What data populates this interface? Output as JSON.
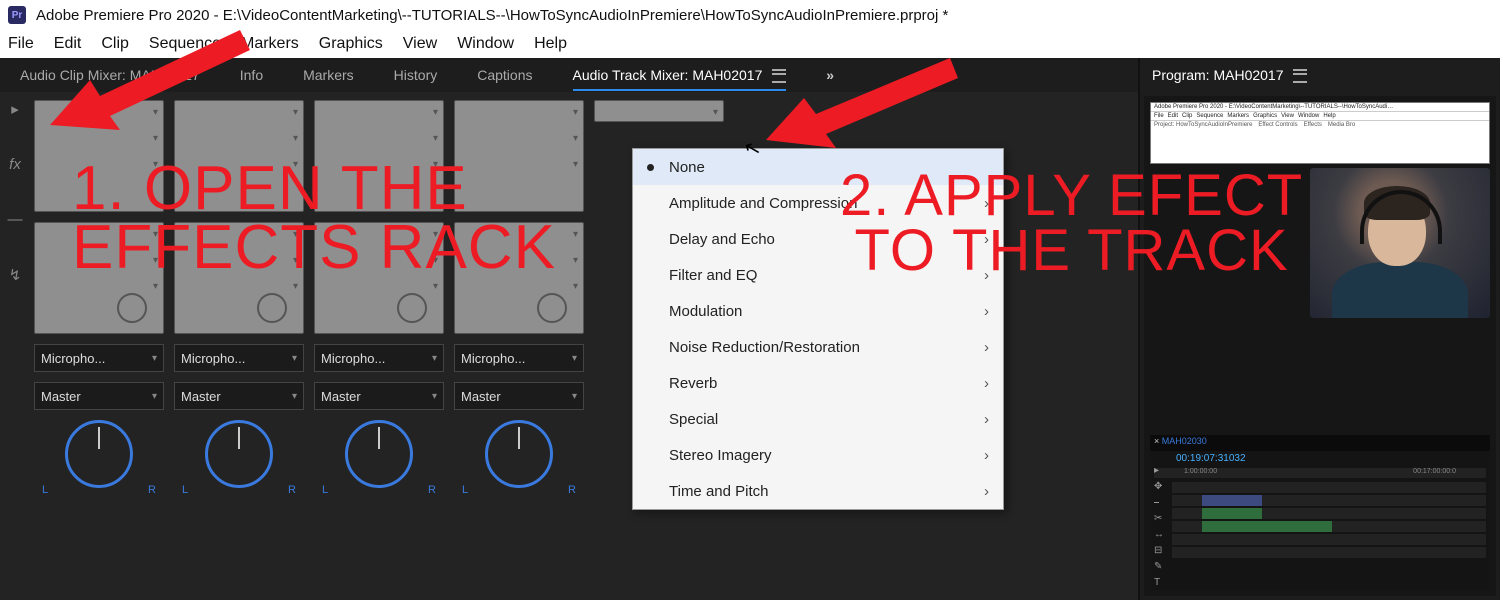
{
  "titlebar": {
    "app_abbrev": "Pr",
    "title": "Adobe Premiere Pro 2020 - E:\\VideoContentMarketing\\--TUTORIALS--\\HowToSyncAudioInPremiere\\HowToSyncAudioInPremiere.prproj *"
  },
  "menu": [
    "File",
    "Edit",
    "Clip",
    "Sequence",
    "Markers",
    "Graphics",
    "View",
    "Window",
    "Help"
  ],
  "panel_tabs_left": [
    {
      "label": "Audio Clip Mixer: MAH02017",
      "active": false
    },
    {
      "label": "Info",
      "active": false
    },
    {
      "label": "Markers",
      "active": false
    },
    {
      "label": "History",
      "active": false
    },
    {
      "label": "Captions",
      "active": false
    },
    {
      "label": "Audio Track Mixer: MAH02017",
      "active": true
    }
  ],
  "overflow_glyph": "»",
  "program_tab": "Program: MAH02017",
  "mixer": {
    "tracks": [
      {
        "input": "Micropho...",
        "output": "Master",
        "pan_left": "L",
        "pan_right": "R"
      },
      {
        "input": "Micropho...",
        "output": "Master",
        "pan_left": "L",
        "pan_right": "R"
      },
      {
        "input": "Micropho...",
        "output": "Master",
        "pan_left": "L",
        "pan_right": "R"
      },
      {
        "input": "Micropho...",
        "output": "Master",
        "pan_left": "L",
        "pan_right": "R"
      }
    ],
    "sidebar_icons": [
      "chevron-right",
      "fx",
      "line",
      "routing"
    ]
  },
  "fx_menu": {
    "selected": "None",
    "items": [
      {
        "label": "None",
        "selected": true,
        "submenu": false
      },
      {
        "label": "Amplitude and Compression",
        "submenu": true
      },
      {
        "label": "Delay and Echo",
        "submenu": true
      },
      {
        "label": "Filter and EQ",
        "submenu": true
      },
      {
        "label": "Modulation",
        "submenu": true
      },
      {
        "label": "Noise Reduction/Restoration",
        "submenu": true
      },
      {
        "label": "Reverb",
        "submenu": true
      },
      {
        "label": "Special",
        "submenu": true
      },
      {
        "label": "Stereo Imagery",
        "submenu": true
      },
      {
        "label": "Time and Pitch",
        "submenu": true
      }
    ]
  },
  "program_panel": {
    "mini_title": "Adobe Premiere Pro 2020 - E:\\VideoContentMarketing\\--TUTORIALS--\\HowToSyncAudi…",
    "mini_menu": [
      "File",
      "Edit",
      "Clip",
      "Sequence",
      "Markers",
      "Graphics",
      "View",
      "Window",
      "Help"
    ],
    "mini_row2": [
      "Project: HowToSyncAudioInPremiere",
      "Effect Controls",
      "Effects",
      "Media Bro"
    ],
    "timeline": {
      "seq_name": "MAH02030",
      "timecode": "00:19:07:31032",
      "ruler": [
        "1:00:00:00",
        "00:17:00:00:0"
      ],
      "tool_icons": [
        "▸",
        "✥",
        "⎯",
        "✂",
        "↔",
        "⊟",
        "✎",
        "T"
      ]
    }
  },
  "annotations": {
    "a1_l1": "1. OPEN THE",
    "a1_l2": "EFFECTS RACK",
    "a2_l1": "2. APPLY EFECT",
    "a2_l2": "TO THE TRACK"
  },
  "colors": {
    "accent_red": "#ed1c24",
    "accent_blue": "#2d8ceb"
  }
}
